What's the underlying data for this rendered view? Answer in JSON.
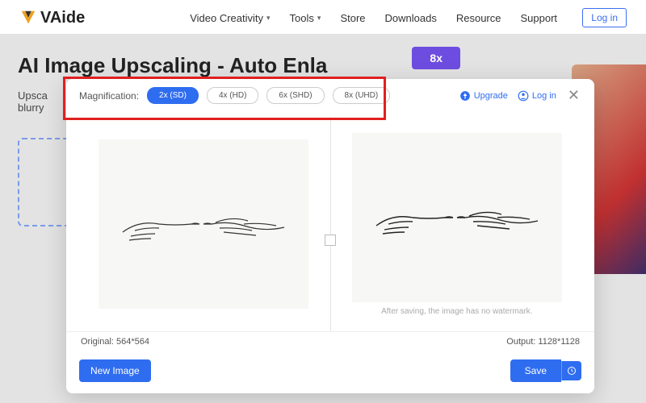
{
  "nav": {
    "brand": "VAide",
    "items": [
      "Video Creativity",
      "Tools",
      "Store",
      "Downloads",
      "Resource",
      "Support"
    ],
    "login": "Log in"
  },
  "hero": {
    "title": "AI Image Upscaling - Auto Enla",
    "sub_line1": "Upsca",
    "sub_line2": "blurry",
    "badge": "8x"
  },
  "modal": {
    "mag_label": "Magnification:",
    "mag_options": [
      "2x (SD)",
      "4x (HD)",
      "6x (SHD)",
      "8x (UHD)"
    ],
    "mag_active_index": 0,
    "upgrade": "Upgrade",
    "login": "Log in",
    "watermark_note": "After saving, the image has no watermark.",
    "original_label": "Original: 564*564",
    "output_label": "Output: 1128*1128",
    "new_image": "New Image",
    "save": "Save"
  },
  "colors": {
    "primary": "#2f6df0",
    "highlight": "#e02020"
  }
}
